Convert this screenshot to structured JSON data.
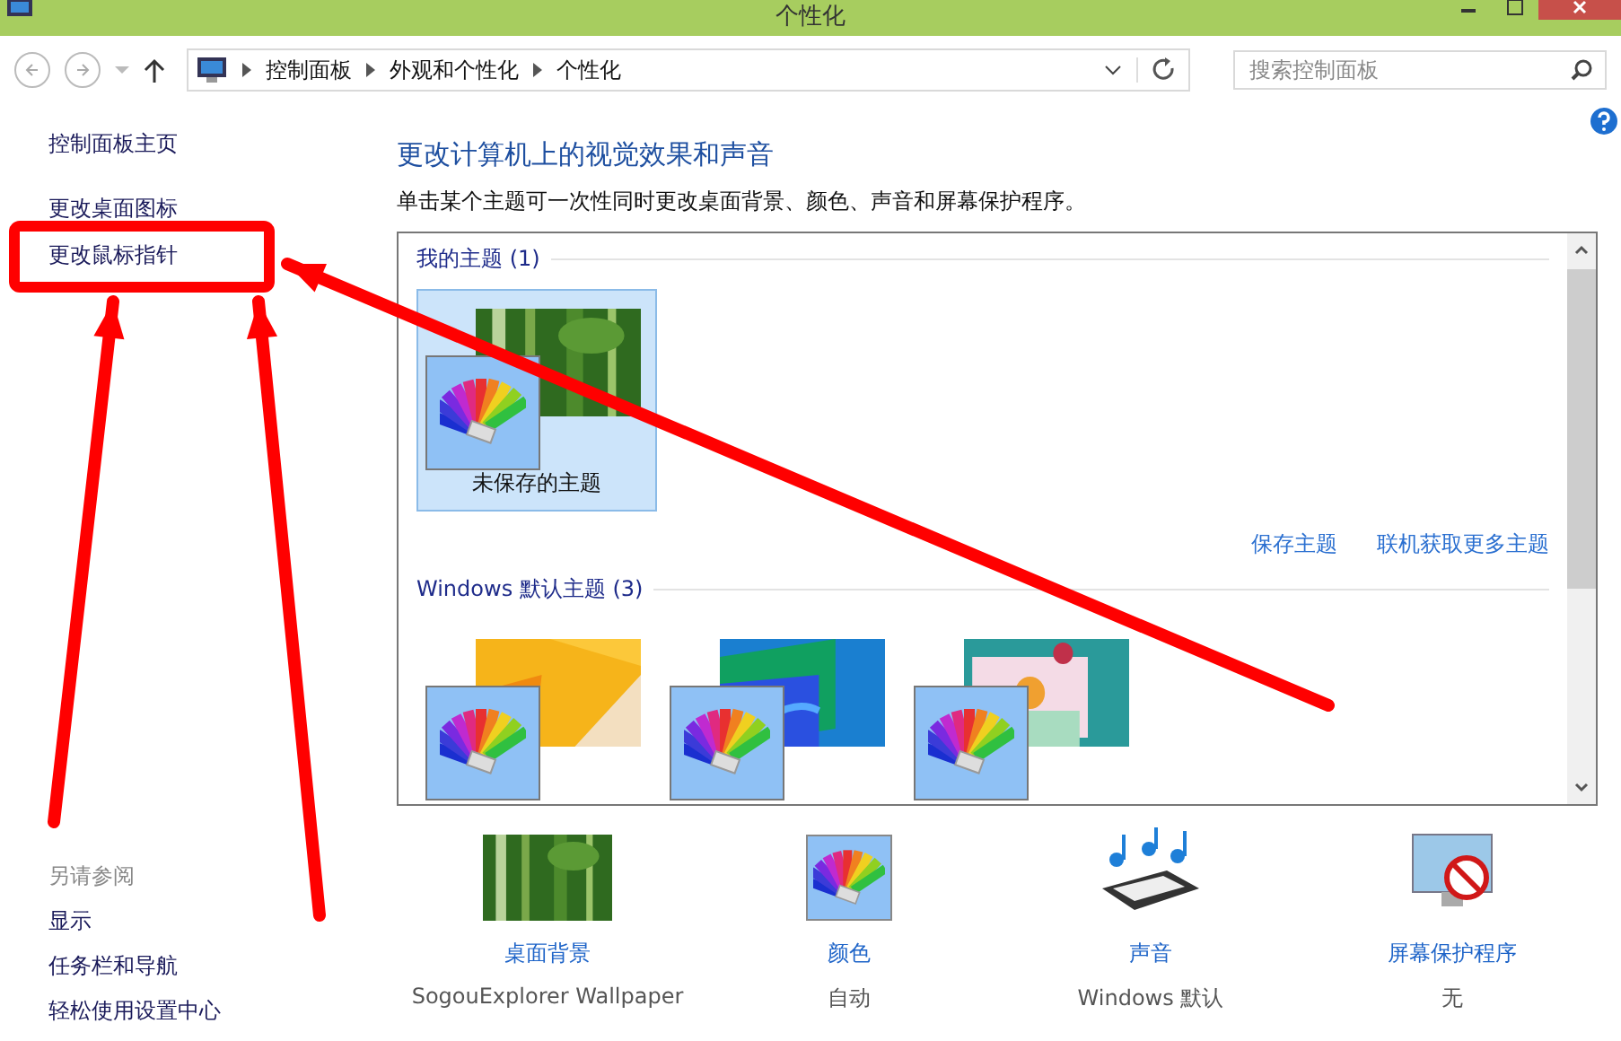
{
  "window": {
    "title": "个性化"
  },
  "address": {
    "crumbs": [
      "控制面板",
      "外观和个性化",
      "个性化"
    ]
  },
  "search": {
    "placeholder": "搜索控制面板"
  },
  "sidebar": {
    "items": [
      {
        "label": "控制面板主页"
      },
      {
        "label": "更改桌面图标"
      },
      {
        "label": "更改鼠标指针"
      }
    ],
    "see_also": {
      "heading": "另请参阅",
      "items": [
        "显示",
        "任务栏和导航",
        "轻松使用设置中心"
      ]
    }
  },
  "main": {
    "heading": "更改计算机上的视觉效果和声音",
    "description": "单击某个主题可一次性同时更改桌面背景、颜色、声音和屏幕保护程序。",
    "groups": [
      {
        "title": "我的主题 (1)",
        "themes": [
          {
            "name": "未保存的主题",
            "selected": true,
            "kind": "bamboo"
          }
        ],
        "links": [
          "保存主题",
          "联机获取更多主题"
        ]
      },
      {
        "title": "Windows 默认主题 (3)",
        "themes": [
          {
            "selected": false,
            "kind": "orange"
          },
          {
            "selected": false,
            "kind": "lines"
          },
          {
            "selected": false,
            "kind": "flowers"
          }
        ]
      }
    ]
  },
  "settings": [
    {
      "label": "桌面背景",
      "value": "SogouExplorer Wallpaper",
      "kind": "wallpaper"
    },
    {
      "label": "颜色",
      "value": "自动",
      "kind": "color"
    },
    {
      "label": "声音",
      "value": "Windows 默认",
      "kind": "sound"
    },
    {
      "label": "屏幕保护程序",
      "value": "无",
      "kind": "screensaver"
    }
  ],
  "annotations": [
    {
      "kind": "box"
    },
    {
      "kind": "arrow"
    },
    {
      "kind": "arrow"
    },
    {
      "kind": "arrow"
    }
  ]
}
